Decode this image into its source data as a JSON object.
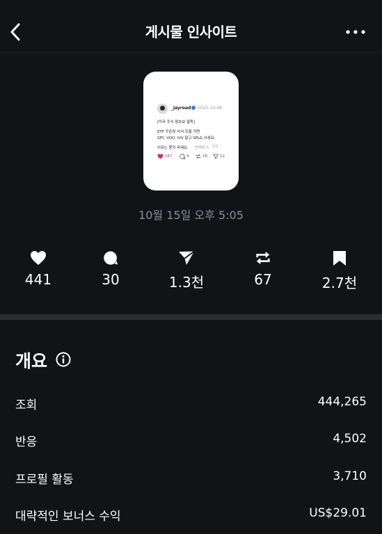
{
  "header": {
    "title": "게시물 인사이트"
  },
  "post": {
    "username": "_jayroad",
    "date": "2025-10-08",
    "text_lines": [
      "[미국 주식 왕초보 필독]",
      "ETF 꾸준히 사서 모을 거면",
      "SPY, VOO, IVV 말고 SPLG 사세요.",
      "이유는 묻지 마세요."
    ],
    "translate_label": "번역하기",
    "page_indicator": "1/2",
    "likes": "167",
    "replies": "9",
    "reposts": "18",
    "shares": "12"
  },
  "published": "10월 15일 오후 5:05",
  "stats": [
    {
      "icon": "heart-icon",
      "value": "441"
    },
    {
      "icon": "comment-icon",
      "value": "30"
    },
    {
      "icon": "share-icon",
      "value": "1.3천"
    },
    {
      "icon": "repost-icon",
      "value": "67"
    },
    {
      "icon": "bookmark-icon",
      "value": "2.7천"
    }
  ],
  "overview": {
    "title": "개요",
    "rows": [
      {
        "label": "조회",
        "value": "444,265"
      },
      {
        "label": "반응",
        "value": "4,502"
      },
      {
        "label": "프로필 활동",
        "value": "3,710"
      },
      {
        "label": "대략적인 보너스 수익",
        "value": "US$29.01"
      }
    ]
  },
  "colors": {
    "background": "#101417",
    "muted_text": "#8a8f94",
    "divider": "#2a2e31",
    "like_red": "#e0245e",
    "verified_blue": "#2f7bf6"
  }
}
